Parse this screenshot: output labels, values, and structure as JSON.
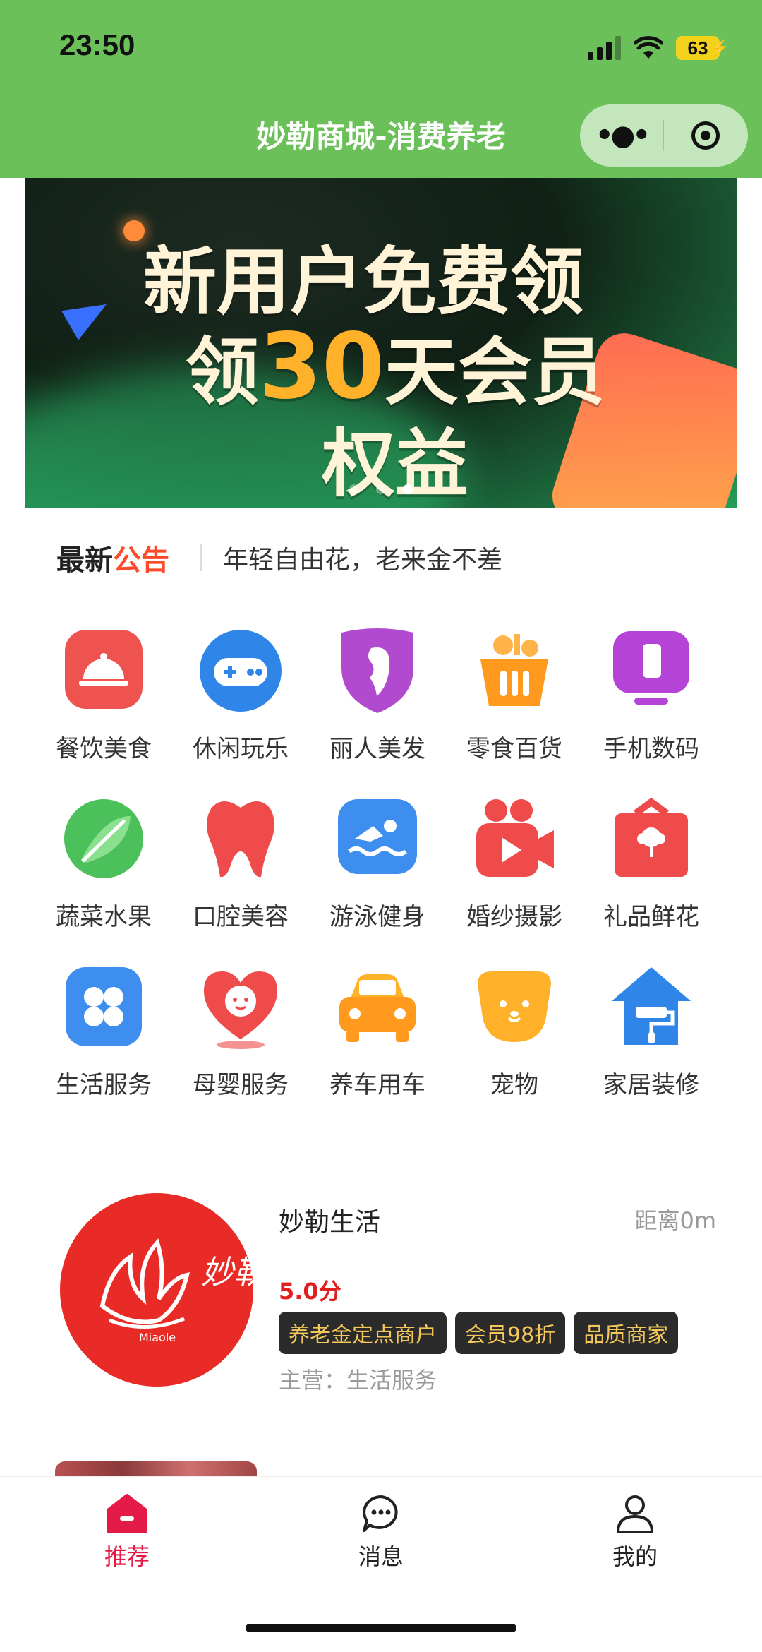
{
  "status_bar": {
    "time": "23:50",
    "battery": "63"
  },
  "nav": {
    "title": "妙勒商城-消费养老",
    "more_glyph": "•●•"
  },
  "banner": {
    "line1": "新用户免费领",
    "line2_prefix": "领",
    "line2_number": "30",
    "line2_suffix": "天会员",
    "line3": "权益",
    "active_dot": 3,
    "dot_count": 3
  },
  "notice": {
    "title_part1": "最新",
    "title_part2": "公告",
    "text": "年轻自由花，老来金不差"
  },
  "categories": [
    {
      "label": "餐饮美食",
      "icon": "cloche-icon"
    },
    {
      "label": "休闲玩乐",
      "icon": "gamepad-icon"
    },
    {
      "label": "丽人美发",
      "icon": "beauty-icon"
    },
    {
      "label": "零食百货",
      "icon": "basket-icon"
    },
    {
      "label": "手机数码",
      "icon": "monitor-icon"
    },
    {
      "label": "蔬菜水果",
      "icon": "leaf-icon"
    },
    {
      "label": "口腔美容",
      "icon": "tooth-icon"
    },
    {
      "label": "游泳健身",
      "icon": "swim-icon"
    },
    {
      "label": "婚纱摄影",
      "icon": "video-camera-icon"
    },
    {
      "label": "礼品鲜花",
      "icon": "gift-icon"
    },
    {
      "label": "生活服务",
      "icon": "four-grid-icon"
    },
    {
      "label": "母婴服务",
      "icon": "baby-heart-icon"
    },
    {
      "label": "养车用车",
      "icon": "car-icon"
    },
    {
      "label": "宠物",
      "icon": "dog-icon"
    },
    {
      "label": "家居装修",
      "icon": "house-roller-icon"
    }
  ],
  "merchant": {
    "name": "妙勒生活",
    "distance": "距离0m",
    "score": "5.0分",
    "tags": [
      "养老金定点商户",
      "会员98折",
      "品质商家"
    ],
    "main_business": "主营：生活服务",
    "logo_text": "妙勒",
    "logo_subtext": "Miaole"
  },
  "tabs": [
    {
      "label": "推荐",
      "icon": "home-icon",
      "active": true
    },
    {
      "label": "消息",
      "icon": "message-icon",
      "active": false
    },
    {
      "label": "我的",
      "icon": "user-icon",
      "active": false
    }
  ],
  "colors": {
    "nav_green": "#6cc05a",
    "accent_red": "#e31b46",
    "tag_gold": "#f3c75a"
  }
}
